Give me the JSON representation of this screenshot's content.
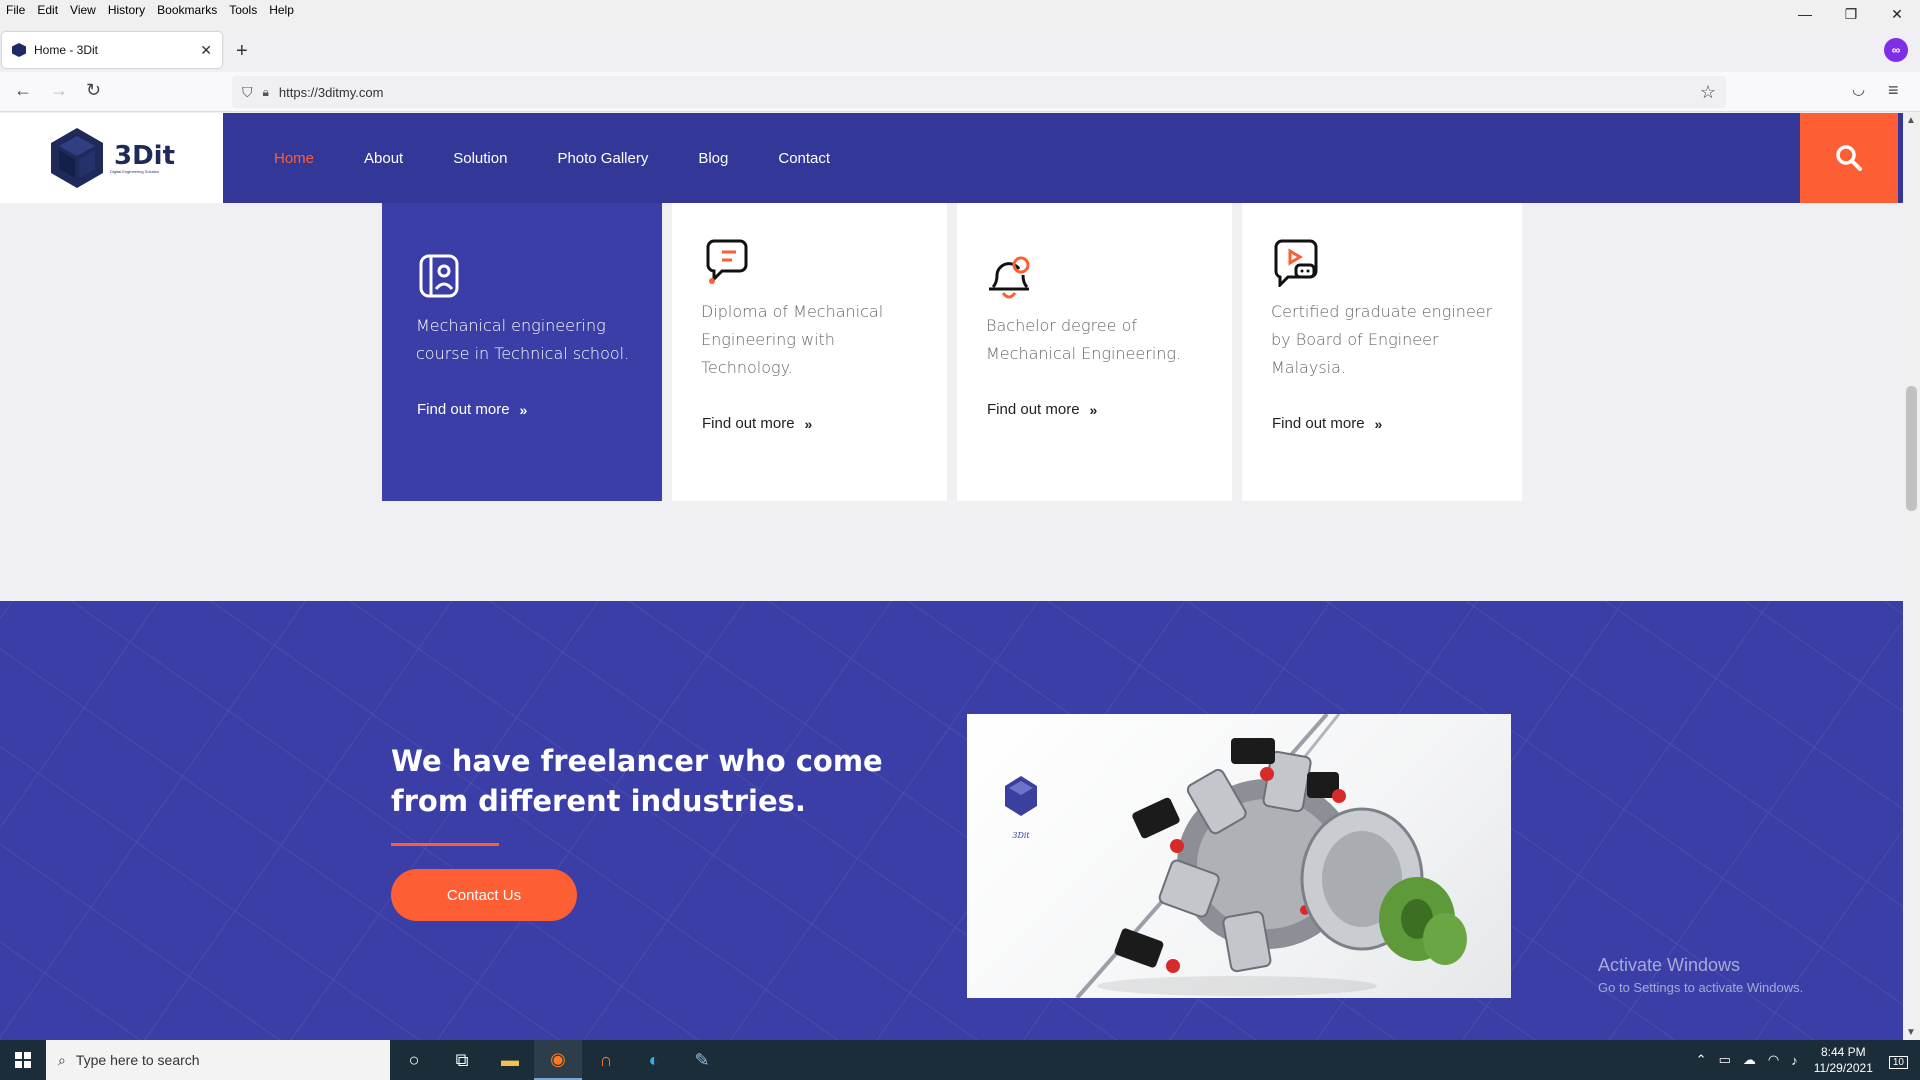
{
  "browser": {
    "menu": [
      "File",
      "Edit",
      "View",
      "History",
      "Bookmarks",
      "Tools",
      "Help"
    ],
    "tab_title": "Home - 3Dit",
    "url": "https://3ditmy.com"
  },
  "site": {
    "brand": "3Dit",
    "brand_tagline": "Digital Engineering Solution",
    "nav": [
      "Home",
      "About",
      "Solution",
      "Photo Gallery",
      "Blog",
      "Contact"
    ],
    "active_nav": "Home",
    "accent_color": "#fd5e33",
    "primary_color": "#3a3ea6"
  },
  "cards": [
    {
      "text": "Mechanical engineering course in Technical school.",
      "link": "Find out more",
      "icon": "id-card-icon"
    },
    {
      "text": "Diploma of Mechanical Engineering with Technology.",
      "link": "Find out more",
      "icon": "chat-note-icon"
    },
    {
      "text": "Bachelor degree of Mechanical Engineering.",
      "link": "Find out more",
      "icon": "bell-icon"
    },
    {
      "text": "Certified graduate engineer by Board of Engineer Malaysia.",
      "link": "Find out more",
      "icon": "video-chat-icon"
    }
  ],
  "band": {
    "headline": "We have freelancer who come from different industries.",
    "cta": "Contact Us",
    "photo_logo": "3Dit"
  },
  "windows": {
    "watermark_title": "Activate Windows",
    "watermark_sub": "Go to Settings to activate Windows.",
    "search_placeholder": "Type here to search",
    "time": "8:44 PM",
    "date": "11/29/2021",
    "notifications": "10"
  }
}
